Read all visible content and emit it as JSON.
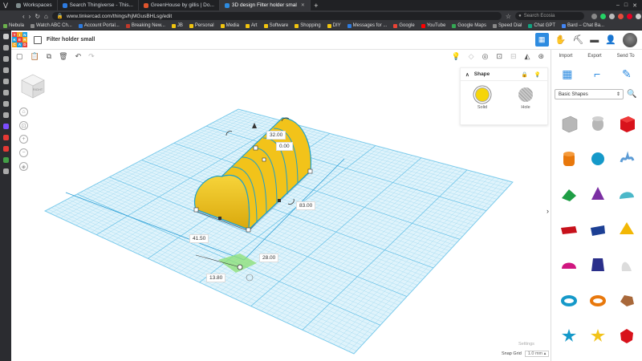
{
  "browser": {
    "tabs": [
      {
        "label": "Workspaces",
        "color": "#7f8c8d"
      },
      {
        "label": "Search Thingiverse - This...",
        "color": "#2d7be0"
      },
      {
        "label": "GreenHouse by gillis | Do...",
        "color": "#e0552d"
      },
      {
        "label": "3D design Filter holder smal",
        "color": "#2d8be0"
      }
    ],
    "url": "www.tinkercad.com/things/hjMGusBHLsg/edit",
    "search_placeholder": "Search Ecosia",
    "bookmarks": [
      {
        "label": "Nebula",
        "color": "#6ab04c"
      },
      {
        "label": "Watch ABC Ch...",
        "color": "#888888"
      },
      {
        "label": "Account Portal...",
        "color": "#2d7be0"
      },
      {
        "label": "Breaking New...",
        "color": "#c0392b"
      },
      {
        "label": "JB",
        "color": "#f1c40f"
      },
      {
        "label": "Personal",
        "color": "#f1c40f"
      },
      {
        "label": "Media",
        "color": "#f1c40f"
      },
      {
        "label": "Art",
        "color": "#f1c40f"
      },
      {
        "label": "Software",
        "color": "#f1c40f"
      },
      {
        "label": "Shopping",
        "color": "#f1c40f"
      },
      {
        "label": "DIY",
        "color": "#f1c40f"
      },
      {
        "label": "Messages for ...",
        "color": "#2d7be0"
      },
      {
        "label": "Google",
        "color": "#ea4335"
      },
      {
        "label": "YouTube",
        "color": "#ff0000"
      },
      {
        "label": "Google Maps",
        "color": "#34a853"
      },
      {
        "label": "Speed Dial",
        "color": "#888888"
      },
      {
        "label": "Chat GPT",
        "color": "#10a37f"
      },
      {
        "label": "Bard – Chat Ba...",
        "color": "#4285f4"
      }
    ]
  },
  "header": {
    "logo_letters": [
      "TIN",
      "KER",
      "CAD"
    ],
    "title": "Filter holder small"
  },
  "right_panel": {
    "import_label": "Import",
    "export_label": "Export",
    "send_label": "Send To",
    "category": "Basic Shapes"
  },
  "shape_panel": {
    "title": "Shape",
    "solid_label": "Solid",
    "hole_label": "Hole"
  },
  "viewcube_label": "RIGHT",
  "dimensions": {
    "height": "32.00",
    "elevation": "0.00",
    "length": "83.00",
    "width": "41.50",
    "pos_y": "28.00",
    "pos_x": "13.80"
  },
  "footer": {
    "settings_label": "Settings",
    "snap_label": "Snap Grid",
    "snap_value": "1.0 mm ▴"
  },
  "colors": {
    "accent": "#2d8be0",
    "shape": "#f2c31a",
    "grid": "#8fd3ef"
  }
}
